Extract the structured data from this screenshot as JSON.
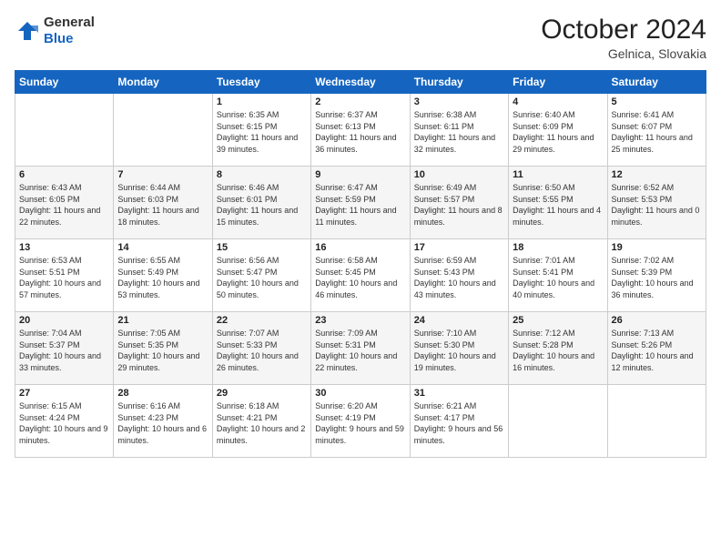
{
  "header": {
    "logo_general": "General",
    "logo_blue": "Blue",
    "month": "October 2024",
    "location": "Gelnica, Slovakia"
  },
  "weekdays": [
    "Sunday",
    "Monday",
    "Tuesday",
    "Wednesday",
    "Thursday",
    "Friday",
    "Saturday"
  ],
  "weeks": [
    [
      {
        "day": "",
        "info": ""
      },
      {
        "day": "",
        "info": ""
      },
      {
        "day": "1",
        "info": "Sunrise: 6:35 AM\nSunset: 6:15 PM\nDaylight: 11 hours and 39 minutes."
      },
      {
        "day": "2",
        "info": "Sunrise: 6:37 AM\nSunset: 6:13 PM\nDaylight: 11 hours and 36 minutes."
      },
      {
        "day": "3",
        "info": "Sunrise: 6:38 AM\nSunset: 6:11 PM\nDaylight: 11 hours and 32 minutes."
      },
      {
        "day": "4",
        "info": "Sunrise: 6:40 AM\nSunset: 6:09 PM\nDaylight: 11 hours and 29 minutes."
      },
      {
        "day": "5",
        "info": "Sunrise: 6:41 AM\nSunset: 6:07 PM\nDaylight: 11 hours and 25 minutes."
      }
    ],
    [
      {
        "day": "6",
        "info": "Sunrise: 6:43 AM\nSunset: 6:05 PM\nDaylight: 11 hours and 22 minutes."
      },
      {
        "day": "7",
        "info": "Sunrise: 6:44 AM\nSunset: 6:03 PM\nDaylight: 11 hours and 18 minutes."
      },
      {
        "day": "8",
        "info": "Sunrise: 6:46 AM\nSunset: 6:01 PM\nDaylight: 11 hours and 15 minutes."
      },
      {
        "day": "9",
        "info": "Sunrise: 6:47 AM\nSunset: 5:59 PM\nDaylight: 11 hours and 11 minutes."
      },
      {
        "day": "10",
        "info": "Sunrise: 6:49 AM\nSunset: 5:57 PM\nDaylight: 11 hours and 8 minutes."
      },
      {
        "day": "11",
        "info": "Sunrise: 6:50 AM\nSunset: 5:55 PM\nDaylight: 11 hours and 4 minutes."
      },
      {
        "day": "12",
        "info": "Sunrise: 6:52 AM\nSunset: 5:53 PM\nDaylight: 11 hours and 0 minutes."
      }
    ],
    [
      {
        "day": "13",
        "info": "Sunrise: 6:53 AM\nSunset: 5:51 PM\nDaylight: 10 hours and 57 minutes."
      },
      {
        "day": "14",
        "info": "Sunrise: 6:55 AM\nSunset: 5:49 PM\nDaylight: 10 hours and 53 minutes."
      },
      {
        "day": "15",
        "info": "Sunrise: 6:56 AM\nSunset: 5:47 PM\nDaylight: 10 hours and 50 minutes."
      },
      {
        "day": "16",
        "info": "Sunrise: 6:58 AM\nSunset: 5:45 PM\nDaylight: 10 hours and 46 minutes."
      },
      {
        "day": "17",
        "info": "Sunrise: 6:59 AM\nSunset: 5:43 PM\nDaylight: 10 hours and 43 minutes."
      },
      {
        "day": "18",
        "info": "Sunrise: 7:01 AM\nSunset: 5:41 PM\nDaylight: 10 hours and 40 minutes."
      },
      {
        "day": "19",
        "info": "Sunrise: 7:02 AM\nSunset: 5:39 PM\nDaylight: 10 hours and 36 minutes."
      }
    ],
    [
      {
        "day": "20",
        "info": "Sunrise: 7:04 AM\nSunset: 5:37 PM\nDaylight: 10 hours and 33 minutes."
      },
      {
        "day": "21",
        "info": "Sunrise: 7:05 AM\nSunset: 5:35 PM\nDaylight: 10 hours and 29 minutes."
      },
      {
        "day": "22",
        "info": "Sunrise: 7:07 AM\nSunset: 5:33 PM\nDaylight: 10 hours and 26 minutes."
      },
      {
        "day": "23",
        "info": "Sunrise: 7:09 AM\nSunset: 5:31 PM\nDaylight: 10 hours and 22 minutes."
      },
      {
        "day": "24",
        "info": "Sunrise: 7:10 AM\nSunset: 5:30 PM\nDaylight: 10 hours and 19 minutes."
      },
      {
        "day": "25",
        "info": "Sunrise: 7:12 AM\nSunset: 5:28 PM\nDaylight: 10 hours and 16 minutes."
      },
      {
        "day": "26",
        "info": "Sunrise: 7:13 AM\nSunset: 5:26 PM\nDaylight: 10 hours and 12 minutes."
      }
    ],
    [
      {
        "day": "27",
        "info": "Sunrise: 6:15 AM\nSunset: 4:24 PM\nDaylight: 10 hours and 9 minutes."
      },
      {
        "day": "28",
        "info": "Sunrise: 6:16 AM\nSunset: 4:23 PM\nDaylight: 10 hours and 6 minutes."
      },
      {
        "day": "29",
        "info": "Sunrise: 6:18 AM\nSunset: 4:21 PM\nDaylight: 10 hours and 2 minutes."
      },
      {
        "day": "30",
        "info": "Sunrise: 6:20 AM\nSunset: 4:19 PM\nDaylight: 9 hours and 59 minutes."
      },
      {
        "day": "31",
        "info": "Sunrise: 6:21 AM\nSunset: 4:17 PM\nDaylight: 9 hours and 56 minutes."
      },
      {
        "day": "",
        "info": ""
      },
      {
        "day": "",
        "info": ""
      }
    ]
  ]
}
